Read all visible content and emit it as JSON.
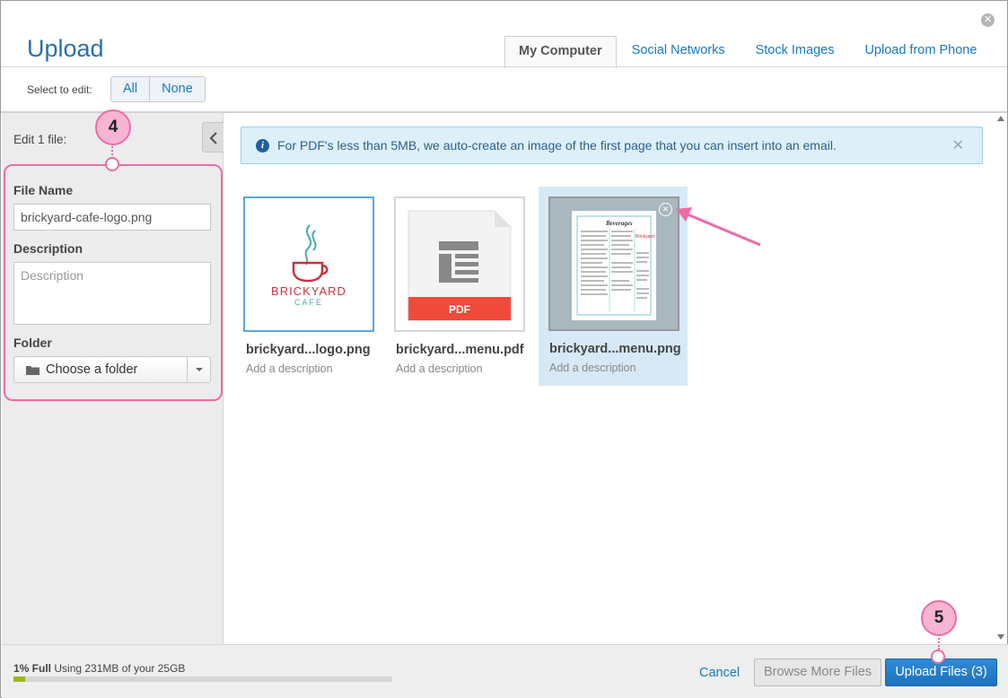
{
  "dialog": {
    "title": "Upload",
    "close_icon": "close-circle-icon"
  },
  "tabs": [
    {
      "label": "My Computer",
      "active": true
    },
    {
      "label": "Social Networks",
      "active": false
    },
    {
      "label": "Stock Images",
      "active": false
    },
    {
      "label": "Upload from Phone",
      "active": false
    }
  ],
  "toolbar": {
    "select_label": "Select to edit:",
    "all_label": "All",
    "none_label": "None"
  },
  "sidebar": {
    "edit_count": "Edit 1 file:",
    "file_name_label": "File Name",
    "file_name_value": "brickyard-cafe-logo.png",
    "description_label": "Description",
    "description_placeholder": "Description",
    "folder_label": "Folder",
    "folder_value": "Choose a folder"
  },
  "info": {
    "text": "For PDF's less than 5MB, we auto-create an image of the first page that you can insert into an email."
  },
  "files": [
    {
      "name": "brickyard...logo.png",
      "description": "Add a description",
      "selected": false,
      "logo_text": "BRICKYARD",
      "logo_subtext": "CAFE"
    },
    {
      "name": "brickyard...menu.pdf",
      "description": "Add a description",
      "selected": false,
      "badge": "PDF"
    },
    {
      "name": "brickyard...menu.png",
      "description": "Add a description",
      "selected": true
    }
  ],
  "footer": {
    "usage_percent": "1% Full",
    "usage_text": "Using 231MB of your 25GB",
    "usage_fraction": 0.01,
    "cancel_label": "Cancel",
    "browse_label": "Browse More Files",
    "upload_label": "Upload Files (3)"
  },
  "annotations": {
    "step_a": "4",
    "step_b": "5"
  },
  "colors": {
    "accent": "#1a7ac0",
    "title": "#2c6fa7",
    "annotation": "#ee6ba7",
    "pdf_badge": "#f04a3b",
    "logo_red": "#c8343f",
    "logo_teal": "#4aa9b4"
  }
}
